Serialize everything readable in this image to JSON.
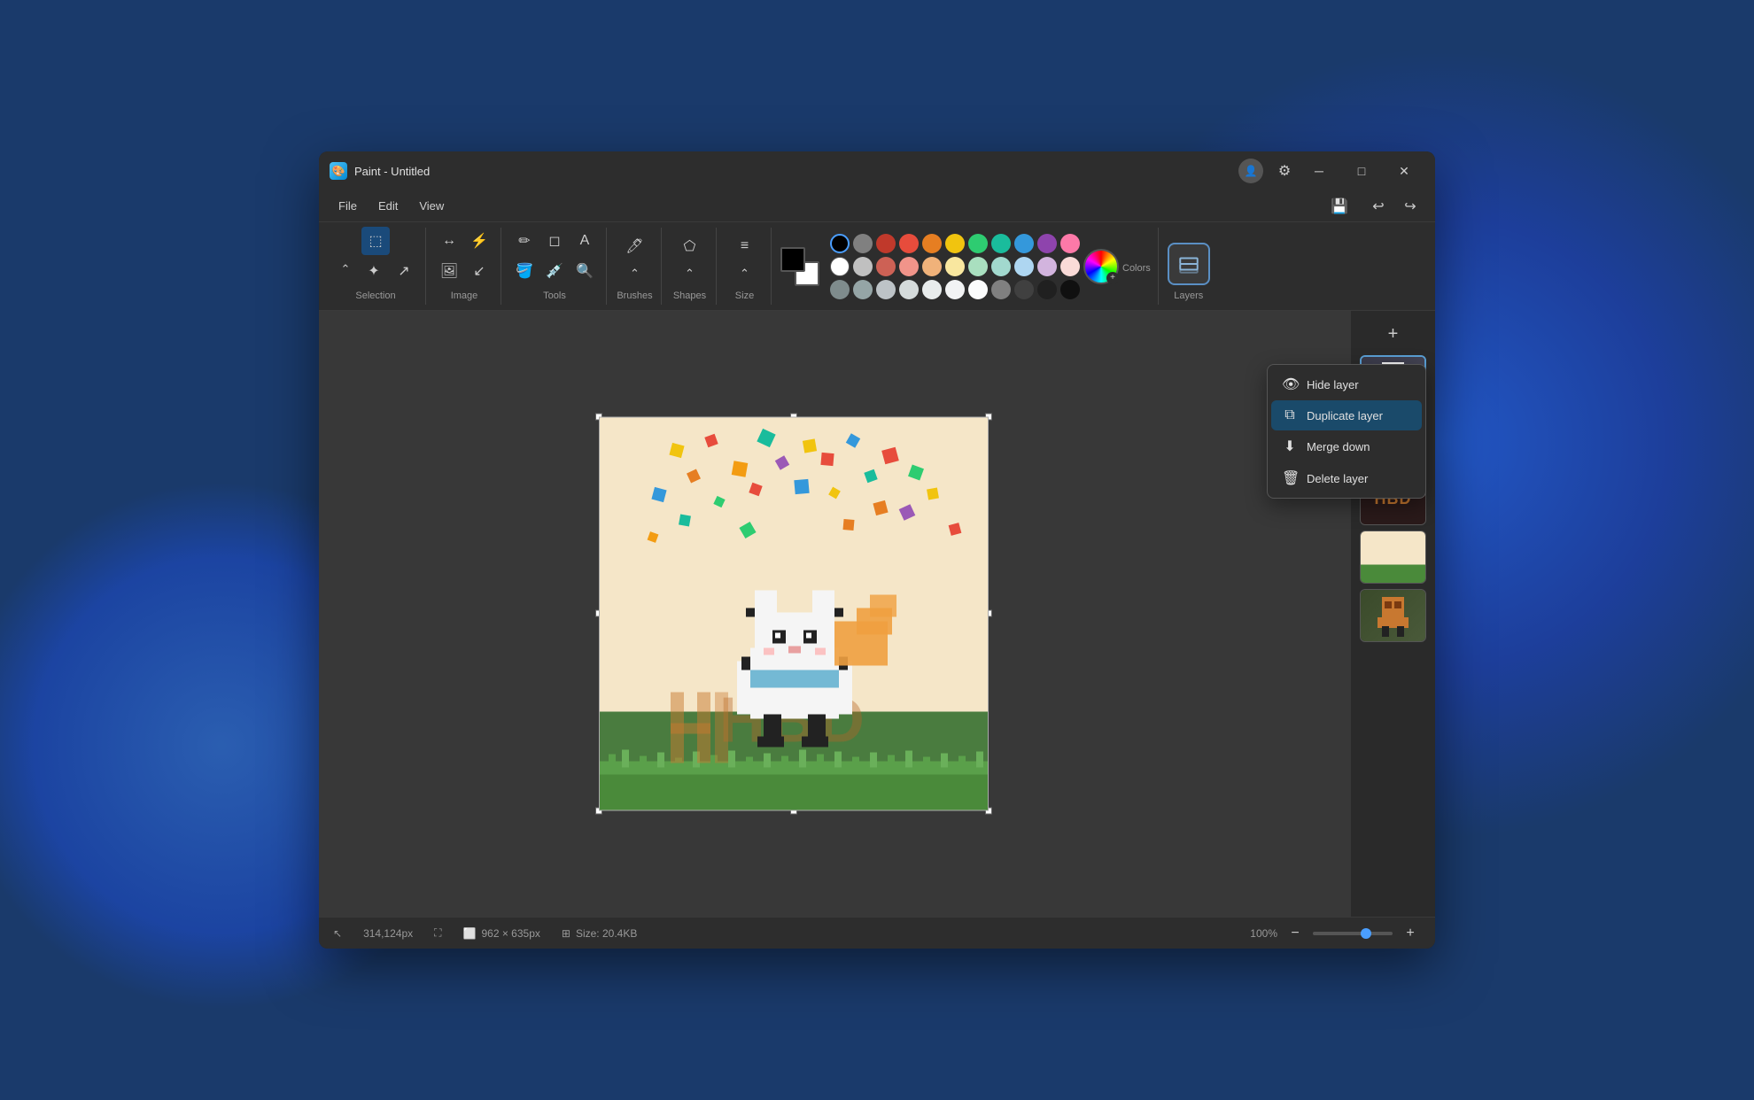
{
  "window": {
    "title": "Paint - Untitled",
    "icon": "🎨"
  },
  "titlebar": {
    "title": "Paint - Untitled",
    "minimize_label": "─",
    "maximize_label": "□",
    "close_label": "✕"
  },
  "menubar": {
    "file": "File",
    "edit": "Edit",
    "view": "View",
    "undo": "↩",
    "redo": "↪"
  },
  "toolbar": {
    "selection_label": "Selection",
    "image_label": "Image",
    "tools_label": "Tools",
    "brushes_label": "Brushes",
    "shapes_label": "Shapes",
    "size_label": "Size",
    "colors_label": "Colors",
    "layers_label": "Layers"
  },
  "colors": {
    "row1": [
      "#000000",
      "#808080",
      "#c0392b",
      "#e74c3c",
      "#e67e22",
      "#f1c40f",
      "#2ecc71",
      "#1abc9c",
      "#3498db",
      "#8e44ad",
      "#fd79a8"
    ],
    "row2": [
      "#ffffff",
      "#c0c0c0",
      "#cd6155",
      "#f1948a",
      "#f0b27a",
      "#f9e79f",
      "#a9dfbf",
      "#a2d9ce",
      "#aed6f1",
      "#d2b4de",
      "#fadbd8"
    ],
    "row3": [
      "#7f8c8d",
      "#95a5a6",
      "#bdc3c7",
      "#d5dbdb",
      "#e8ecec",
      "#f2f3f4",
      "#fbfcfc",
      "#808080",
      "#404040",
      "#202020",
      "#101010"
    ]
  },
  "status": {
    "coordinates": "314,124px",
    "dimensions": "962 × 635px",
    "size": "Size: 20.4KB",
    "zoom": "100%"
  },
  "layers_panel": {
    "add_label": "+"
  },
  "context_menu": {
    "hide_layer": "Hide layer",
    "duplicate_layer": "Duplicate layer",
    "merge_down": "Merge down",
    "delete_layer": "Delete layer"
  }
}
